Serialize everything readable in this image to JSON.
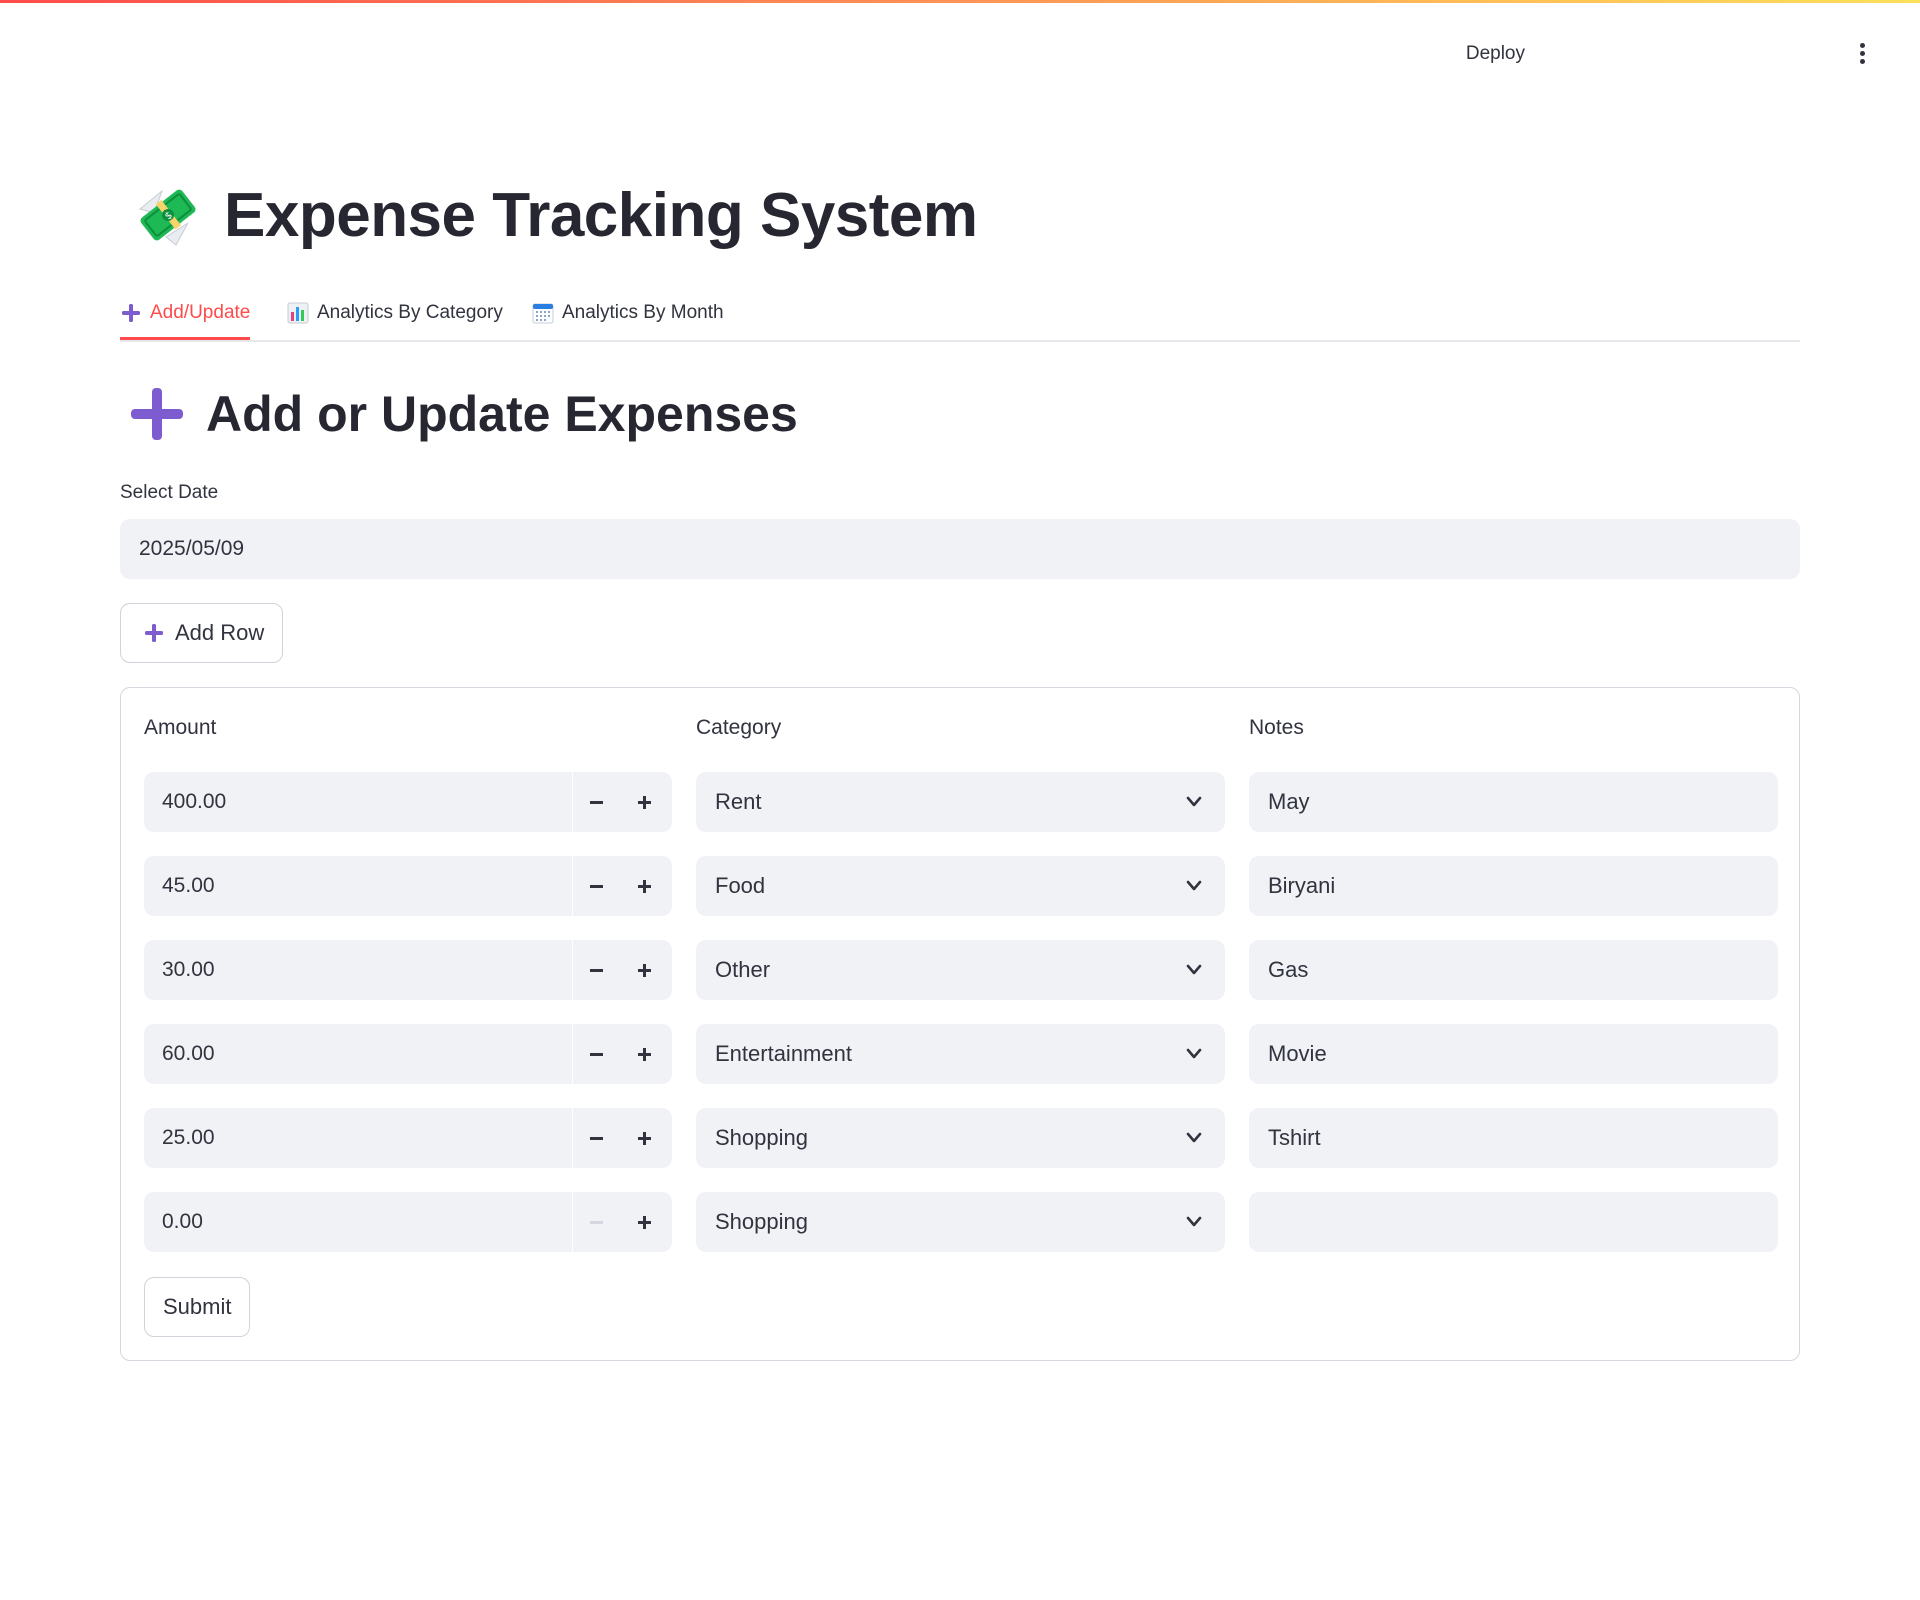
{
  "header": {
    "deploy_label": "Deploy",
    "menu_icon": "vertical-dots-icon"
  },
  "app": {
    "title": "Expense Tracking System",
    "title_icon": "money-with-wings-icon"
  },
  "tabs": [
    {
      "label": "Add/Update",
      "icon": "plus-icon",
      "active": true
    },
    {
      "label": "Analytics By Category",
      "icon": "bar-chart-icon",
      "active": false
    },
    {
      "label": "Analytics By Month",
      "icon": "calendar-icon",
      "active": false
    }
  ],
  "section": {
    "title": "Add or Update Expenses",
    "icon": "plus-icon"
  },
  "date": {
    "label": "Select Date",
    "value": "2025/05/09"
  },
  "add_row_label": "Add Row",
  "columns": {
    "amount": "Amount",
    "category": "Category",
    "notes": "Notes"
  },
  "rows": [
    {
      "amount": "400.00",
      "category": "Rent",
      "notes": "May",
      "minus_disabled": false
    },
    {
      "amount": "45.00",
      "category": "Food",
      "notes": "Biryani",
      "minus_disabled": false
    },
    {
      "amount": "30.00",
      "category": "Other",
      "notes": "Gas",
      "minus_disabled": false
    },
    {
      "amount": "60.00",
      "category": "Entertainment",
      "notes": "Movie",
      "minus_disabled": false
    },
    {
      "amount": "25.00",
      "category": "Shopping",
      "notes": "Tshirt",
      "minus_disabled": false
    },
    {
      "amount": "0.00",
      "category": "Shopping",
      "notes": "",
      "minus_disabled": true
    }
  ],
  "submit_label": "Submit",
  "colors": {
    "accent": "#ff4b4b",
    "plus_purple": "#7d5ccf",
    "input_bg": "#f0f2f6",
    "text": "#31333f"
  }
}
